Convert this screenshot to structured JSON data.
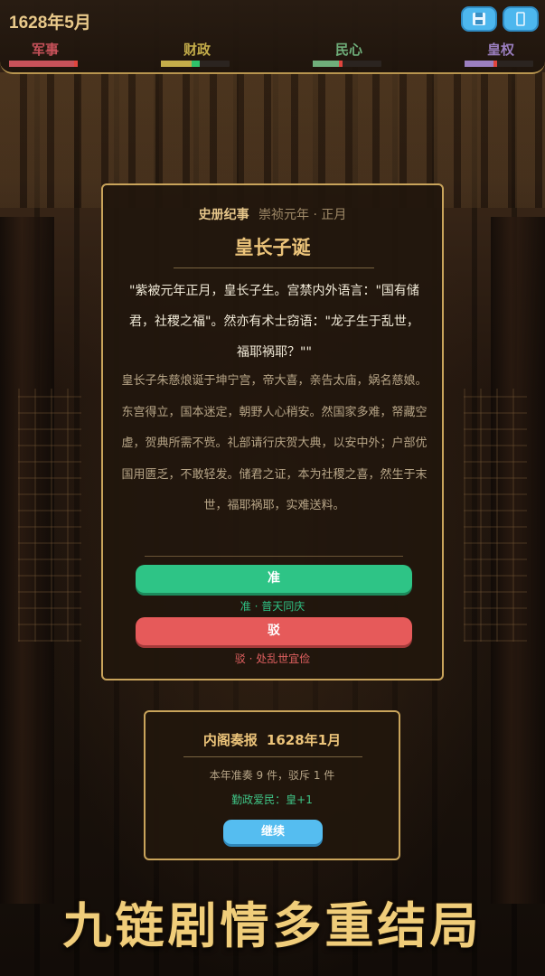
{
  "header": {
    "date": "1628年5月",
    "save_icon": "save-icon",
    "menu_icon": "menu-icon",
    "stats": [
      {
        "label": "军事",
        "value": 0.97,
        "color": "#c8525a",
        "marker_color": "#e0453d"
      },
      {
        "label": "财政",
        "value": 0.45,
        "color": "#c4ad4a",
        "marker_color": "#2fc46a"
      },
      {
        "label": "民心",
        "value": 0.38,
        "color": "#6fae7a",
        "marker_color": "#e0453d"
      },
      {
        "label": "皇权",
        "value": 0.42,
        "color": "#9b7fc0",
        "marker_color": "#e0453d"
      }
    ]
  },
  "event": {
    "tag": "史册纪事",
    "era": "崇祯元年 · 正月",
    "title": "皇长子诞",
    "quote": "\"紫被元年正月，皇长子生。宫禁内外语言：\"国有储君，社稷之福\"。然亦有术士窃语：\"龙子生于乱世，福耶祸耶？\"\"",
    "story": "皇长子朱慈烺诞于坤宁宫，帝大喜，亲告太庙，娲名慈娘。东宫得立，国本迷定，朝野人心稍安。然国家多难，帑藏空虚，贺典所需不赀。礼部请行庆贺大典，以安中外；户部优国用匮乏，不敢轻发。储君之证，本为社稷之喜，然生于末世，福耶祸耶，实难送料。",
    "approve_label": "准",
    "approve_note": "准 · 普天同庆",
    "reject_label": "驳",
    "reject_note": "驳 · 处乱世宜俭"
  },
  "report": {
    "title": "内阁奏报",
    "date": "1628年1月",
    "summary": "本年准奏 9 件，驳斥 1 件",
    "effect": "勤政爱民：皇+1",
    "continue_label": "继续"
  },
  "banner": "九链剧情多重结局"
}
